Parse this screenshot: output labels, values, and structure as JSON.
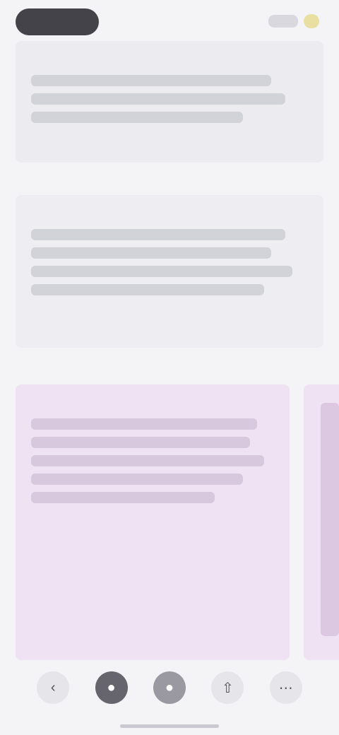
{
  "status_bar": {
    "left_pill": "",
    "icons": [
      "signal-icon",
      "battery-icon"
    ]
  },
  "cards": [
    {
      "label": "",
      "body": ""
    },
    {
      "label": "",
      "body": ""
    },
    {
      "label": "",
      "body": ""
    }
  ],
  "bottom_bar": {
    "buttons": [
      {
        "icon": "back-icon",
        "glyph": "‹"
      },
      {
        "icon": "record-icon",
        "glyph": "●"
      },
      {
        "icon": "stop-icon",
        "glyph": "●"
      },
      {
        "icon": "share-icon",
        "glyph": "⇧"
      },
      {
        "icon": "more-icon",
        "glyph": "⋯"
      }
    ]
  },
  "colors": {
    "background": "#f4f4f7",
    "card_grey": "#ececf0",
    "card_pink": "#efe2f3",
    "pill_dark": "#44434a"
  }
}
